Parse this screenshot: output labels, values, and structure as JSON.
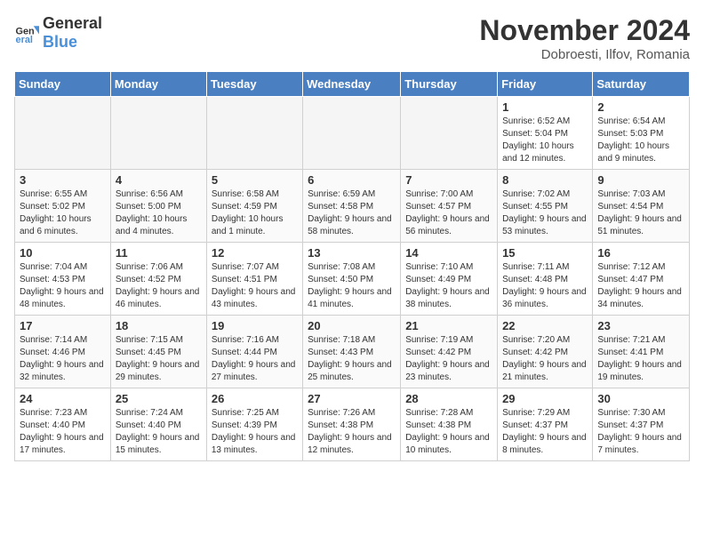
{
  "header": {
    "logo_general": "General",
    "logo_blue": "Blue",
    "month_year": "November 2024",
    "location": "Dobroesti, Ilfov, Romania"
  },
  "days_of_week": [
    "Sunday",
    "Monday",
    "Tuesday",
    "Wednesday",
    "Thursday",
    "Friday",
    "Saturday"
  ],
  "weeks": [
    [
      {
        "day": "",
        "info": ""
      },
      {
        "day": "",
        "info": ""
      },
      {
        "day": "",
        "info": ""
      },
      {
        "day": "",
        "info": ""
      },
      {
        "day": "",
        "info": ""
      },
      {
        "day": "1",
        "info": "Sunrise: 6:52 AM\nSunset: 5:04 PM\nDaylight: 10 hours and 12 minutes."
      },
      {
        "day": "2",
        "info": "Sunrise: 6:54 AM\nSunset: 5:03 PM\nDaylight: 10 hours and 9 minutes."
      }
    ],
    [
      {
        "day": "3",
        "info": "Sunrise: 6:55 AM\nSunset: 5:02 PM\nDaylight: 10 hours and 6 minutes."
      },
      {
        "day": "4",
        "info": "Sunrise: 6:56 AM\nSunset: 5:00 PM\nDaylight: 10 hours and 4 minutes."
      },
      {
        "day": "5",
        "info": "Sunrise: 6:58 AM\nSunset: 4:59 PM\nDaylight: 10 hours and 1 minute."
      },
      {
        "day": "6",
        "info": "Sunrise: 6:59 AM\nSunset: 4:58 PM\nDaylight: 9 hours and 58 minutes."
      },
      {
        "day": "7",
        "info": "Sunrise: 7:00 AM\nSunset: 4:57 PM\nDaylight: 9 hours and 56 minutes."
      },
      {
        "day": "8",
        "info": "Sunrise: 7:02 AM\nSunset: 4:55 PM\nDaylight: 9 hours and 53 minutes."
      },
      {
        "day": "9",
        "info": "Sunrise: 7:03 AM\nSunset: 4:54 PM\nDaylight: 9 hours and 51 minutes."
      }
    ],
    [
      {
        "day": "10",
        "info": "Sunrise: 7:04 AM\nSunset: 4:53 PM\nDaylight: 9 hours and 48 minutes."
      },
      {
        "day": "11",
        "info": "Sunrise: 7:06 AM\nSunset: 4:52 PM\nDaylight: 9 hours and 46 minutes."
      },
      {
        "day": "12",
        "info": "Sunrise: 7:07 AM\nSunset: 4:51 PM\nDaylight: 9 hours and 43 minutes."
      },
      {
        "day": "13",
        "info": "Sunrise: 7:08 AM\nSunset: 4:50 PM\nDaylight: 9 hours and 41 minutes."
      },
      {
        "day": "14",
        "info": "Sunrise: 7:10 AM\nSunset: 4:49 PM\nDaylight: 9 hours and 38 minutes."
      },
      {
        "day": "15",
        "info": "Sunrise: 7:11 AM\nSunset: 4:48 PM\nDaylight: 9 hours and 36 minutes."
      },
      {
        "day": "16",
        "info": "Sunrise: 7:12 AM\nSunset: 4:47 PM\nDaylight: 9 hours and 34 minutes."
      }
    ],
    [
      {
        "day": "17",
        "info": "Sunrise: 7:14 AM\nSunset: 4:46 PM\nDaylight: 9 hours and 32 minutes."
      },
      {
        "day": "18",
        "info": "Sunrise: 7:15 AM\nSunset: 4:45 PM\nDaylight: 9 hours and 29 minutes."
      },
      {
        "day": "19",
        "info": "Sunrise: 7:16 AM\nSunset: 4:44 PM\nDaylight: 9 hours and 27 minutes."
      },
      {
        "day": "20",
        "info": "Sunrise: 7:18 AM\nSunset: 4:43 PM\nDaylight: 9 hours and 25 minutes."
      },
      {
        "day": "21",
        "info": "Sunrise: 7:19 AM\nSunset: 4:42 PM\nDaylight: 9 hours and 23 minutes."
      },
      {
        "day": "22",
        "info": "Sunrise: 7:20 AM\nSunset: 4:42 PM\nDaylight: 9 hours and 21 minutes."
      },
      {
        "day": "23",
        "info": "Sunrise: 7:21 AM\nSunset: 4:41 PM\nDaylight: 9 hours and 19 minutes."
      }
    ],
    [
      {
        "day": "24",
        "info": "Sunrise: 7:23 AM\nSunset: 4:40 PM\nDaylight: 9 hours and 17 minutes."
      },
      {
        "day": "25",
        "info": "Sunrise: 7:24 AM\nSunset: 4:40 PM\nDaylight: 9 hours and 15 minutes."
      },
      {
        "day": "26",
        "info": "Sunrise: 7:25 AM\nSunset: 4:39 PM\nDaylight: 9 hours and 13 minutes."
      },
      {
        "day": "27",
        "info": "Sunrise: 7:26 AM\nSunset: 4:38 PM\nDaylight: 9 hours and 12 minutes."
      },
      {
        "day": "28",
        "info": "Sunrise: 7:28 AM\nSunset: 4:38 PM\nDaylight: 9 hours and 10 minutes."
      },
      {
        "day": "29",
        "info": "Sunrise: 7:29 AM\nSunset: 4:37 PM\nDaylight: 9 hours and 8 minutes."
      },
      {
        "day": "30",
        "info": "Sunrise: 7:30 AM\nSunset: 4:37 PM\nDaylight: 9 hours and 7 minutes."
      }
    ]
  ]
}
